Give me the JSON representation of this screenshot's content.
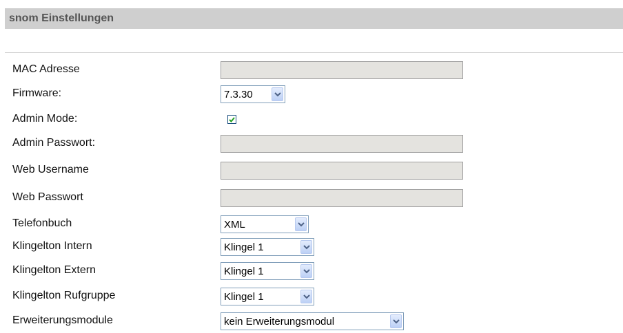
{
  "header": {
    "title": "snom Einstellungen"
  },
  "fields": {
    "mac": {
      "label": "MAC Adresse",
      "value": ""
    },
    "firmware": {
      "label": "Firmware:",
      "value": "7.3.30"
    },
    "admin_mode": {
      "label": "Admin Mode:",
      "checked": true
    },
    "admin_password": {
      "label": "Admin Passwort:",
      "value": ""
    },
    "web_username": {
      "label": "Web Username",
      "value": ""
    },
    "web_password": {
      "label": "Web Passwort",
      "value": ""
    },
    "phonebook": {
      "label": "Telefonbuch",
      "value": "XML"
    },
    "ring_internal": {
      "label": "Klingelton Intern",
      "value": "Klingel 1"
    },
    "ring_external": {
      "label": "Klingelton Extern",
      "value": "Klingel 1"
    },
    "ring_group": {
      "label": "Klingelton Rufgruppe",
      "value": "Klingel 1"
    },
    "expansion": {
      "label": "Erweiterungsmodule",
      "value": "kein Erweiterungsmodul"
    }
  },
  "icons": {
    "dropdown": "chevron-down-icon",
    "check": "checkmark-icon"
  },
  "colors": {
    "header_bg": "#cfcfcf",
    "input_bg": "#e4e3df",
    "select_border": "#7f9db9"
  }
}
